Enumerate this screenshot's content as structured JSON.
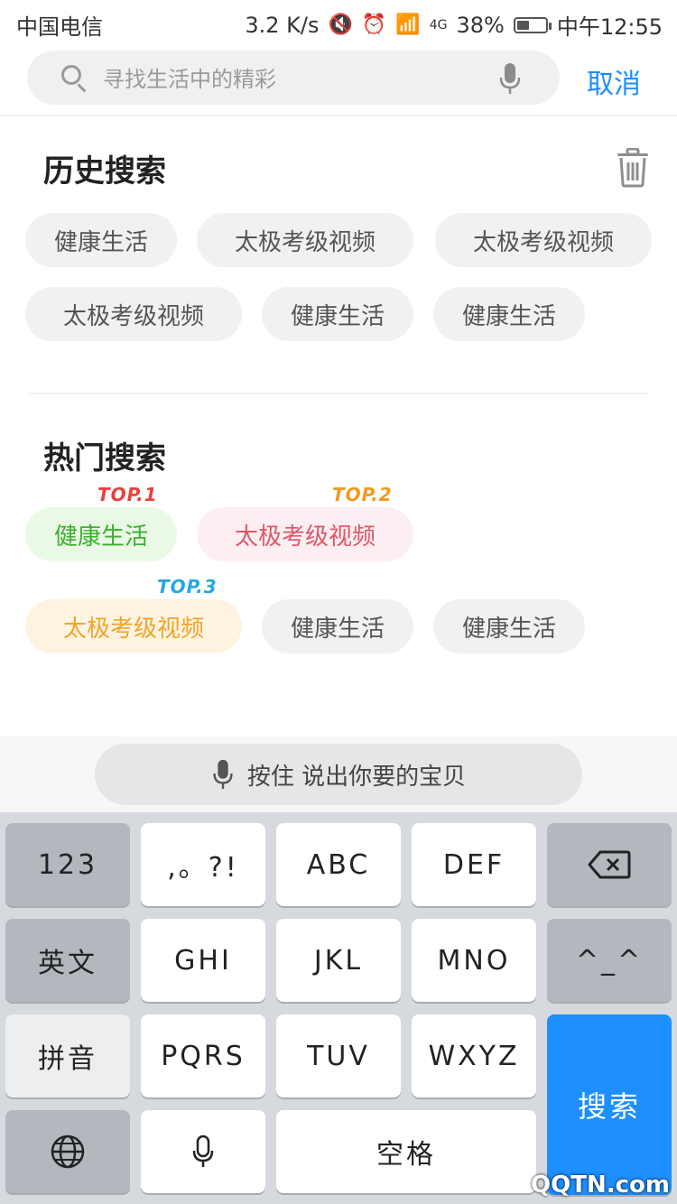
{
  "status_bar": {
    "carrier": "中国电信",
    "speed": "3.2 K/s",
    "network": "4G",
    "battery": "38%",
    "time": "中午12:55"
  },
  "search": {
    "placeholder": "寻找生活中的精彩",
    "cancel_label": "取消"
  },
  "history": {
    "title": "历史搜索",
    "items": [
      "健康生活",
      "太极考级视频",
      "太极考级视频",
      "太极考级视频",
      "健康生活",
      "健康生活"
    ]
  },
  "hot": {
    "title": "热门搜索",
    "items": [
      {
        "label": "健康生活",
        "badge": "TOP.1",
        "bg": "#eaf9e6",
        "color": "#3cb02f",
        "badge_color": "#e8413c"
      },
      {
        "label": "太极考级视频",
        "badge": "TOP.2",
        "bg": "#fdeff1",
        "color": "#e0566a",
        "badge_color": "#f39a1c"
      },
      {
        "label": "太极考级视频",
        "badge": "TOP.3",
        "bg": "#fdf3e0",
        "color": "#f0a52c",
        "badge_color": "#25a9de"
      },
      {
        "label": "健康生活"
      },
      {
        "label": "健康生活"
      }
    ]
  },
  "voice": {
    "label": "按住  说出你要的宝贝"
  },
  "keyboard": {
    "row1": [
      "123",
      ",。?!",
      "ABC",
      "DEF"
    ],
    "row2": [
      "英文",
      "GHI",
      "JKL",
      "MNO",
      "^_^"
    ],
    "row3": [
      "拼音",
      "PQRS",
      "TUV",
      "WXYZ"
    ],
    "space_label": "空格",
    "search_label": "搜索"
  },
  "watermark": "QQTN.com",
  "colors": {
    "accent": "#1e90ff",
    "search_key": "#1e8fff"
  }
}
